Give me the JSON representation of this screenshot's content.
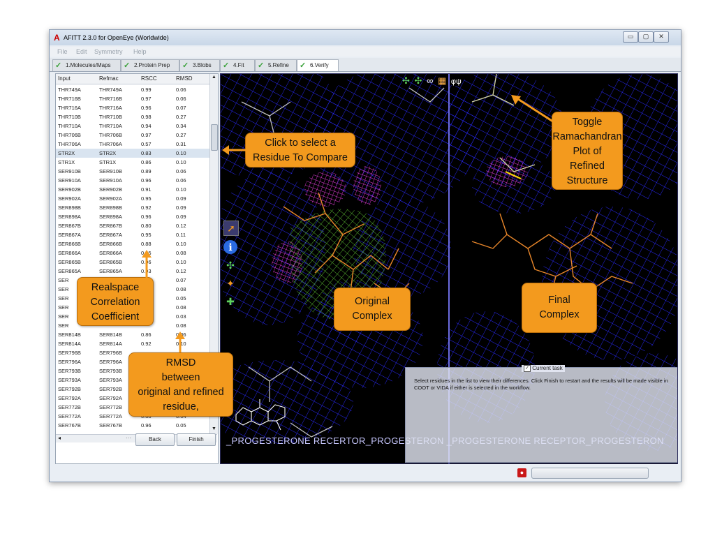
{
  "window": {
    "title": "AFITT 2.3.0 for OpenEye (Worldwide)",
    "app_logo": "A",
    "controls": [
      "▭",
      "▢",
      "✕"
    ]
  },
  "menu": [
    "File",
    "Edit",
    "Symmetry",
    "Help"
  ],
  "tabs": [
    {
      "label": "1.Molecules/Maps",
      "done": true
    },
    {
      "label": "2.Protein Prep",
      "done": true
    },
    {
      "label": "3.Blobs",
      "done": true
    },
    {
      "label": "4.Fit",
      "done": true
    },
    {
      "label": "5.Refine",
      "done": true
    },
    {
      "label": "6.Verify",
      "done": true,
      "active": true
    }
  ],
  "table": {
    "headers": [
      "Input",
      "Refmac",
      "RSCC",
      "RMSD"
    ],
    "rows": [
      [
        "THR749A",
        "THR749A",
        "0.99",
        "0.06"
      ],
      [
        "THR716B",
        "THR716B",
        "0.97",
        "0.06"
      ],
      [
        "THR716A",
        "THR716A",
        "0.96",
        "0.07"
      ],
      [
        "THR710B",
        "THR710B",
        "0.98",
        "0.27"
      ],
      [
        "THR710A",
        "THR710A",
        "0.94",
        "0.34"
      ],
      [
        "THR706B",
        "THR706B",
        "0.97",
        "0.27"
      ],
      [
        "THR706A",
        "THR706A",
        "0.57",
        "0.31"
      ],
      [
        "STR2X",
        "STR2X",
        "0.83",
        "0.10"
      ],
      [
        "STR1X",
        "STR1X",
        "0.86",
        "0.10"
      ],
      [
        "SER910B",
        "SER910B",
        "0.89",
        "0.06"
      ],
      [
        "SER910A",
        "SER910A",
        "0.96",
        "0.06"
      ],
      [
        "SER902B",
        "SER902B",
        "0.91",
        "0.10"
      ],
      [
        "SER902A",
        "SER902A",
        "0.95",
        "0.09"
      ],
      [
        "SER898B",
        "SER898B",
        "0.92",
        "0.09"
      ],
      [
        "SER898A",
        "SER898A",
        "0.96",
        "0.09"
      ],
      [
        "SER867B",
        "SER867B",
        "0.80",
        "0.12"
      ],
      [
        "SER867A",
        "SER867A",
        "0.95",
        "0.11"
      ],
      [
        "SER866B",
        "SER866B",
        "0.88",
        "0.10"
      ],
      [
        "SER866A",
        "SER866A",
        "0.95",
        "0.08"
      ],
      [
        "SER865B",
        "SER865B",
        "0.96",
        "0.10"
      ],
      [
        "SER865A",
        "SER865A",
        "0.93",
        "0.12"
      ],
      [
        "SER",
        "",
        "",
        "0.07"
      ],
      [
        "SER",
        "",
        "",
        "0.08"
      ],
      [
        "SER",
        "",
        "",
        "0.05"
      ],
      [
        "SER",
        "",
        "",
        "0.08"
      ],
      [
        "SER",
        "",
        "",
        "0.03"
      ],
      [
        "SER",
        "",
        "",
        "0.08"
      ],
      [
        "SER814B",
        "SER814B",
        "0.86",
        "0.06"
      ],
      [
        "SER814A",
        "SER814A",
        "0.92",
        "0.10"
      ],
      [
        "SER796B",
        "SER796B",
        "",
        ""
      ],
      [
        "SER796A",
        "SER796A",
        "",
        ""
      ],
      [
        "SER793B",
        "SER793B",
        "",
        ""
      ],
      [
        "SER793A",
        "SER793A",
        "",
        ""
      ],
      [
        "SER792B",
        "SER792B",
        "",
        ""
      ],
      [
        "SER792A",
        "SER792A",
        "",
        ""
      ],
      [
        "SER772B",
        "SER772B",
        "",
        ""
      ],
      [
        "SER772A",
        "SER772A",
        "0.88",
        "0.04"
      ],
      [
        "SER767B",
        "SER767B",
        "0.96",
        "0.05"
      ]
    ],
    "selected_row": "STR2X"
  },
  "buttons": {
    "back": "Back",
    "finish": "Finish"
  },
  "viewer": {
    "bottom_text": "_PROGESTERONE RECERTOR_PROGESTERON _PROGESTERONE RECEPTOR_PROGESTERON",
    "toolbar": [
      "✣",
      "✣",
      "∞",
      "▦",
      "φψ"
    ]
  },
  "task": {
    "legend": "Current task",
    "checked": true,
    "text": "Select residues in the list to view their differences. Click Finish to restart and the results will be made visible in COOT or VIDA if either is selected in the workflow."
  },
  "callouts": {
    "select": [
      "Click to select a",
      "Residue To Compare"
    ],
    "ramachandran": [
      "Toggle",
      "Ramachandran",
      "Plot of",
      "Refined",
      "Structure"
    ],
    "rscc": [
      "Realspace",
      "Correlation",
      "Coefficient"
    ],
    "rmsd": [
      "RMSD",
      "between",
      "original and refined",
      "residue,"
    ],
    "original": [
      "Original",
      "Complex"
    ],
    "final": [
      "Final",
      "Complex"
    ]
  },
  "colors": {
    "callout": "#f39a1e",
    "check": "#3aa13a",
    "mesh_blue": "#2a2aff",
    "mesh_green": "#6bdc3a",
    "mesh_magenta": "#e23bd8",
    "ligand_orange": "#e8862a"
  }
}
